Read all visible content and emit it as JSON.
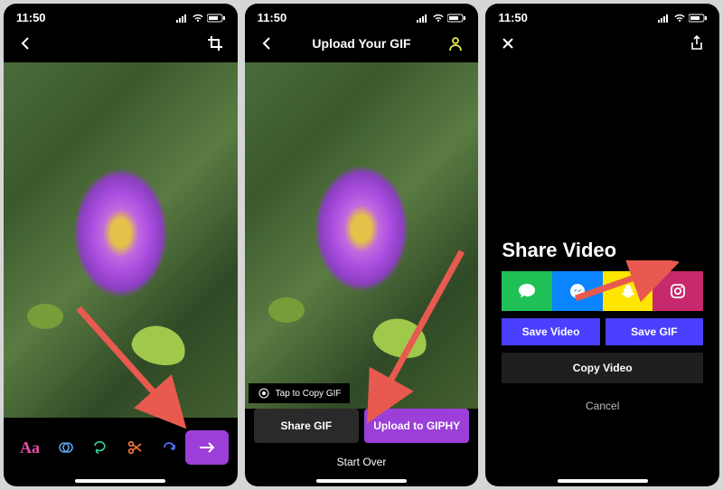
{
  "status": {
    "time": "11:50"
  },
  "screen1": {
    "tools": {
      "text": "Aa"
    }
  },
  "screen2": {
    "title": "Upload Your GIF",
    "tap_hint": "Tap to Copy GIF",
    "share_gif": "Share GIF",
    "upload_giphy": "Upload to GIPHY",
    "start_over": "Start Over"
  },
  "screen3": {
    "header": "Share Video",
    "save_video": "Save Video",
    "save_gif": "Save GIF",
    "copy_video": "Copy Video",
    "cancel": "Cancel"
  }
}
